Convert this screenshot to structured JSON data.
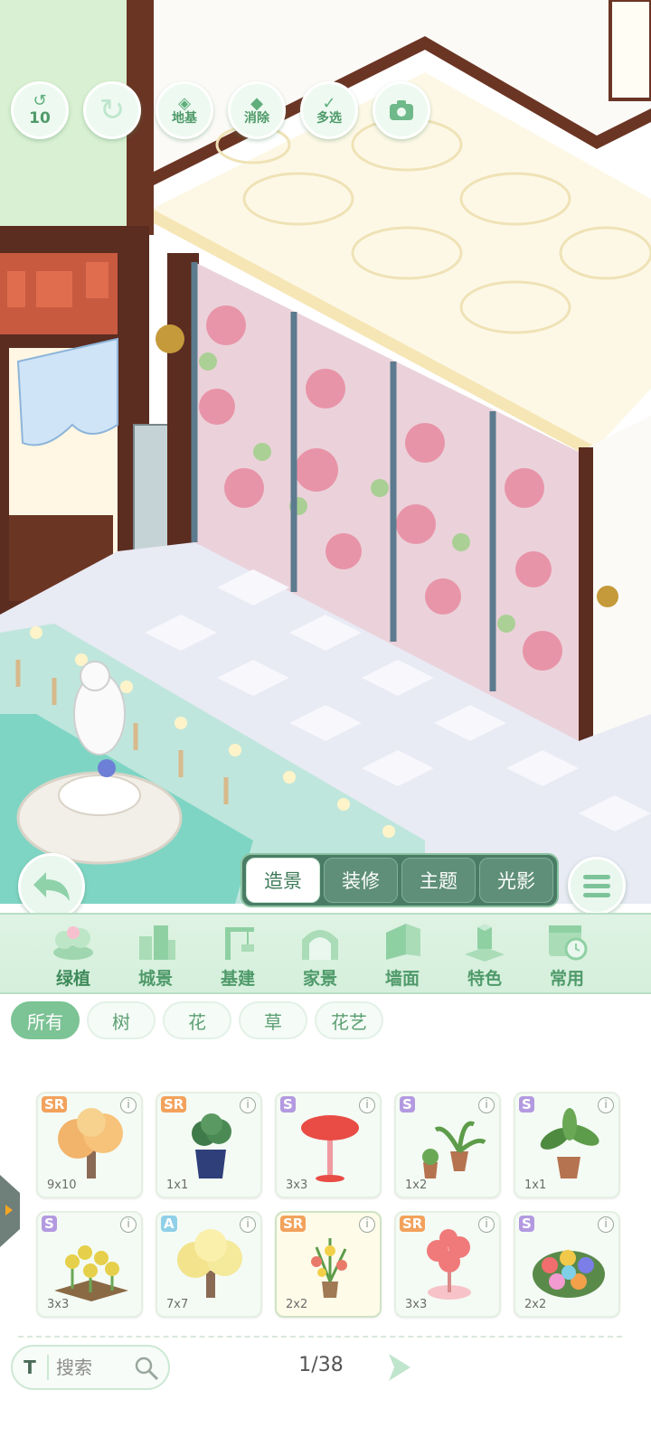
{
  "toolbar": {
    "undo_count": "10",
    "foundation_label": "地基",
    "erase_label": "消除",
    "multiselect_label": "多选",
    "icons": [
      "undo-icon",
      "redo-icon",
      "foundation-icon",
      "eraser-icon",
      "multiselect-icon",
      "camera-icon"
    ]
  },
  "mode_tabs": [
    {
      "label": "造景",
      "active": true
    },
    {
      "label": "装修",
      "active": false
    },
    {
      "label": "主题",
      "active": false
    },
    {
      "label": "光影",
      "active": false
    }
  ],
  "categories": [
    {
      "label": "绿植",
      "icon": "plant-icon",
      "active": true
    },
    {
      "label": "城景",
      "icon": "city-icon",
      "active": false
    },
    {
      "label": "基建",
      "icon": "crane-icon",
      "active": false
    },
    {
      "label": "家景",
      "icon": "home-icon",
      "active": false
    },
    {
      "label": "墙面",
      "icon": "wall-icon",
      "active": false
    },
    {
      "label": "特色",
      "icon": "special-icon",
      "active": false
    },
    {
      "label": "常用",
      "icon": "calendar-clock-icon",
      "active": false
    }
  ],
  "filters": [
    {
      "label": "所有",
      "active": true
    },
    {
      "label": "树",
      "active": false
    },
    {
      "label": "花",
      "active": false
    },
    {
      "label": "草",
      "active": false
    },
    {
      "label": "花艺",
      "active": false
    }
  ],
  "items": [
    {
      "rarity": "SR",
      "size": "9x10",
      "icon": "golden-tree-icon"
    },
    {
      "rarity": "SR",
      "size": "1x1",
      "icon": "potted-plant-blue-pot-icon"
    },
    {
      "rarity": "S",
      "size": "3x3",
      "icon": "red-umbrella-tree-icon"
    },
    {
      "rarity": "S",
      "size": "1x2",
      "icon": "potted-ferns-icon"
    },
    {
      "rarity": "S",
      "size": "1x1",
      "icon": "potted-leafy-plant-icon"
    },
    {
      "rarity": "S",
      "size": "3x3",
      "icon": "yellow-flower-bed-icon"
    },
    {
      "rarity": "A",
      "size": "7x7",
      "icon": "yellow-blossom-tree-icon"
    },
    {
      "rarity": "SR",
      "size": "2x2",
      "icon": "flower-arrangement-icon"
    },
    {
      "rarity": "SR",
      "size": "3x3",
      "icon": "pink-balloon-tree-icon"
    },
    {
      "rarity": "S",
      "size": "2x2",
      "icon": "colorful-flower-bed-icon"
    }
  ],
  "info_glyph": "i",
  "search": {
    "placeholder": "搜索",
    "prefix": "T"
  },
  "pagination": {
    "current": "1/38"
  },
  "colors": {
    "accent": "#7cc395",
    "dark_tab": "#4a7c65",
    "sr_badge": "#f2a25c",
    "s_badge": "#b39ae0",
    "a_badge": "#8fd0e8"
  }
}
